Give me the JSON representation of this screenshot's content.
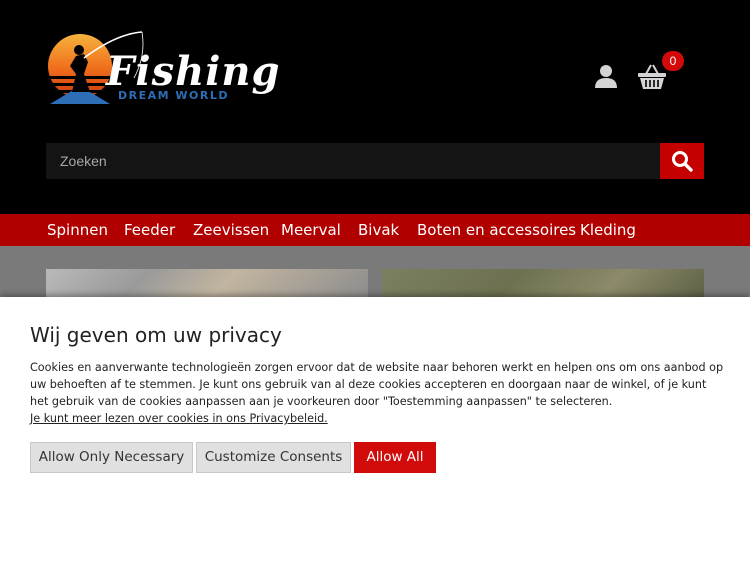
{
  "brand": {
    "name": "Fishing",
    "tagline": "DREAM WORLD"
  },
  "header": {
    "cart_count": "0",
    "search_placeholder": "Zoeken"
  },
  "nav": {
    "items": [
      {
        "label": "Spinnen"
      },
      {
        "label": "Feeder"
      },
      {
        "label": "Zeevissen"
      },
      {
        "label": "Meerval"
      },
      {
        "label": "Bivak"
      },
      {
        "label": "Boten en accessoires"
      },
      {
        "label": "Kleding"
      }
    ]
  },
  "cookie": {
    "title": "Wij geven om uw privacy",
    "body": "Cookies en aanverwante technologieën zorgen ervoor dat de website naar behoren werkt en helpen ons om ons aanbod op uw behoeften af te stemmen. Je kunt ons gebruik van al deze cookies accepteren en doorgaan naar de winkel, of je kunt het gebruik van de cookies aanpassen aan je voorkeuren door \"Toestemming aanpassen\" te selecteren.",
    "link": "Je kunt meer lezen over cookies in ons Privacybeleid.",
    "buttons": {
      "necessary": "Allow Only Necessary",
      "customize": "Customize Consents",
      "allow_all": "Allow All"
    }
  },
  "colors": {
    "header_bg": "#000000",
    "nav_bg": "#b10000",
    "accent": "#d10a0a",
    "badge": "#d20a0a",
    "logo_blue": "#2d6fb6"
  },
  "icons": {
    "user": "user-icon",
    "cart": "basket-icon",
    "search": "search-icon"
  }
}
